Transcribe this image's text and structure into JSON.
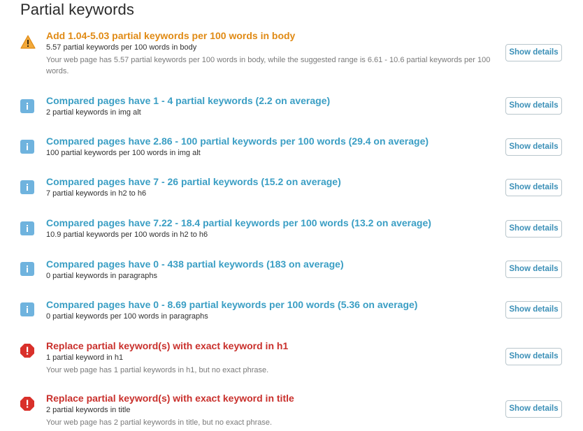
{
  "page": {
    "title": "Partial keywords"
  },
  "colors": {
    "warning": "#e08a14",
    "info": "#3a9ec4",
    "info_icon": "#6fb3de",
    "error": "#c9302c",
    "button_text": "#3a8fb7"
  },
  "items": [
    {
      "type": "warning",
      "icon": "warning-triangle-icon",
      "headline": "Add 1.04-5.03 partial keywords per 100 words in body",
      "sub": "5.57 partial keywords per 100 words in body",
      "desc": "Your web page has 5.57 partial keywords per 100 words in body, while the suggested range is 6.61 - 10.6 partial keywords per 100 words.",
      "button": "Show details"
    },
    {
      "type": "info",
      "icon": "info-icon",
      "headline": "Compared pages have 1 - 4 partial keywords (2.2 on average)",
      "sub": "2 partial keywords in img alt",
      "desc": "",
      "button": "Show details"
    },
    {
      "type": "info",
      "icon": "info-icon",
      "headline": "Compared pages have 2.86 - 100 partial keywords per 100 words (29.4 on average)",
      "sub": "100 partial keywords per 100 words in img alt",
      "desc": "",
      "button": "Show details"
    },
    {
      "type": "info",
      "icon": "info-icon",
      "headline": "Compared pages have 7 - 26 partial keywords (15.2 on average)",
      "sub": "7 partial keywords in h2 to h6",
      "desc": "",
      "button": "Show details"
    },
    {
      "type": "info",
      "icon": "info-icon",
      "headline": "Compared pages have 7.22 - 18.4 partial keywords per 100 words (13.2 on average)",
      "sub": "10.9 partial keywords per 100 words in h2 to h6",
      "desc": "",
      "button": "Show details"
    },
    {
      "type": "info",
      "icon": "info-icon",
      "headline": "Compared pages have 0 - 438 partial keywords (183 on average)",
      "sub": "0 partial keywords in paragraphs",
      "desc": "",
      "button": "Show details"
    },
    {
      "type": "info",
      "icon": "info-icon",
      "headline": "Compared pages have 0 - 8.69 partial keywords per 100 words (5.36 on average)",
      "sub": "0 partial keywords per 100 words in paragraphs",
      "desc": "",
      "button": "Show details"
    },
    {
      "type": "error",
      "icon": "error-icon",
      "headline": "Replace partial keyword(s) with exact keyword in h1",
      "sub": "1 partial keyword in h1",
      "desc": "Your web page has 1 partial keywords in h1, but no exact phrase.",
      "button": "Show details"
    },
    {
      "type": "error",
      "icon": "error-icon",
      "headline": "Replace partial keyword(s) with exact keyword in title",
      "sub": "2 partial keywords in title",
      "desc": "Your web page has 2 partial keywords in title, but no exact phrase.",
      "button": "Show details"
    }
  ]
}
